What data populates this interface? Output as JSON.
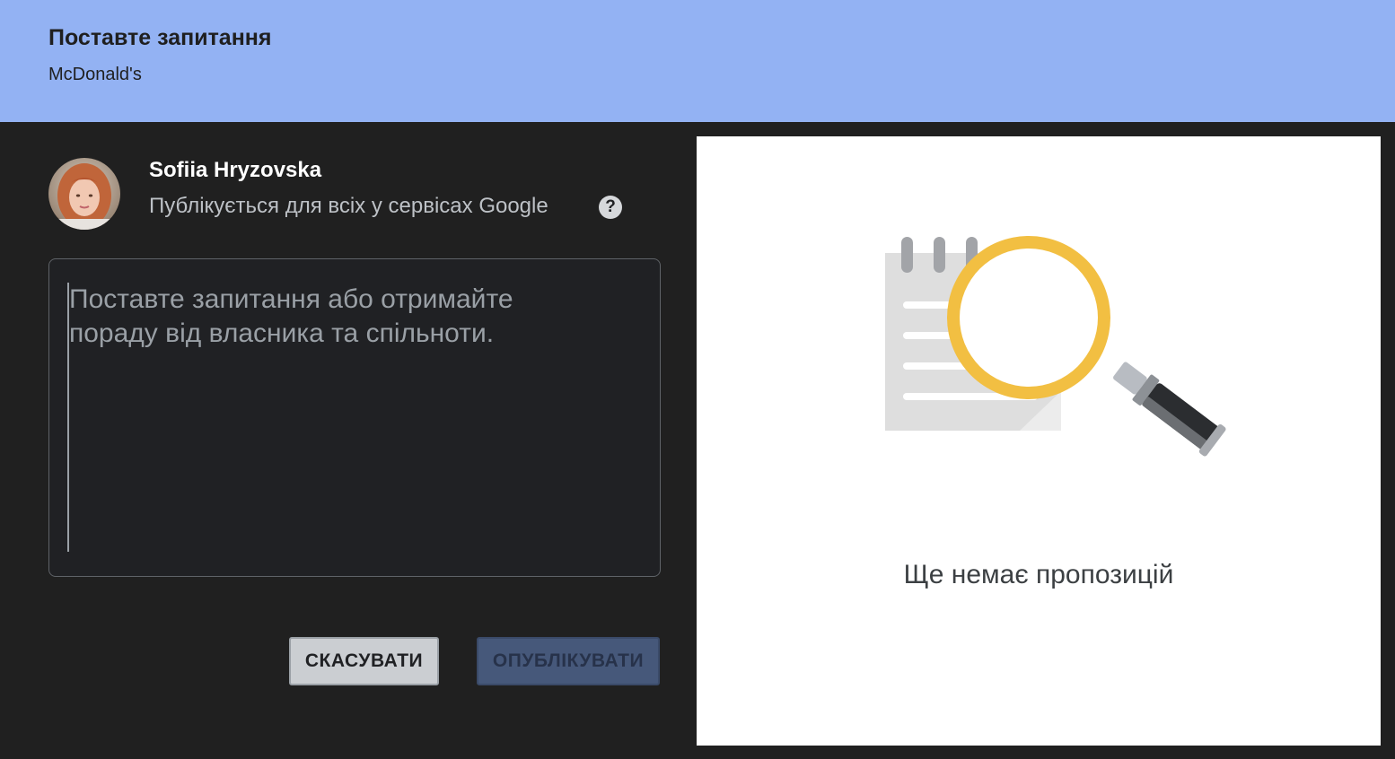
{
  "header": {
    "title": "Поставте запитання",
    "subtitle": "McDonald's"
  },
  "user": {
    "name": "Sofiia Hryzovska",
    "visibility": "Публікується для всіх у сервісах Google",
    "help_glyph": "?"
  },
  "question": {
    "placeholder": "Поставте запитання або отримайте пораду від власника та спільноти.",
    "value": ""
  },
  "actions": {
    "cancel_label": "СКАСУВАТИ",
    "publish_label": "ОПУБЛІКУВАТИ"
  },
  "suggestions": {
    "empty_text": "Ще немає пропозицій",
    "illustration_icon": "magnifier-over-notepad-icon"
  },
  "colors": {
    "header_bg": "#93b2f3",
    "panel_bg": "#202020",
    "magnifier_ring": "#f2bf42",
    "publish_button": "#46587a"
  }
}
